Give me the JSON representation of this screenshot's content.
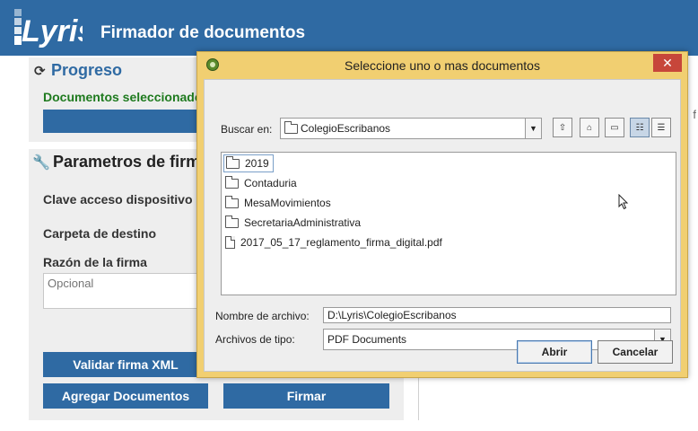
{
  "app": {
    "logo_text": "Lyris",
    "title": "Firmador de documentos"
  },
  "progress": {
    "title": "Progreso",
    "docs_label": "Documentos seleccionados"
  },
  "params": {
    "title": "Parametros de firma",
    "clave_label": "Clave acceso dispositivo",
    "carpeta_label": "Carpeta de destino",
    "razon_label": "Razón de la firma",
    "razon_placeholder": "Opcional"
  },
  "buttons": {
    "validar": "Validar firma XML",
    "agregar": "Agregar Documentos",
    "firmar": "Firmar"
  },
  "right_fragment": {
    "letter": "f"
  },
  "dialog": {
    "title": "Seleccione uno o mas documentos",
    "close_glyph": "✕",
    "look_in_label": "Buscar en:",
    "look_in_value": "ColegioEscribanos",
    "files": [
      {
        "name": "2019",
        "kind": "folder",
        "selected": true
      },
      {
        "name": "Contaduria",
        "kind": "folder"
      },
      {
        "name": "MesaMovimientos",
        "kind": "folder"
      },
      {
        "name": "SecretariaAdministrativa",
        "kind": "folder"
      },
      {
        "name": "2017_05_17_reglamento_firma_digital.pdf",
        "kind": "file"
      }
    ],
    "filename_label": "Nombre de archivo:",
    "filename_value": "D:\\Lyris\\ColegioEscribanos",
    "filetype_label": "Archivos de tipo:",
    "filetype_value": "PDF Documents",
    "open_button": "Abrir",
    "cancel_button": "Cancelar"
  },
  "colors": {
    "brand": "#2f6aa3",
    "dialog_frame": "#f1cf71",
    "close": "#c7463a",
    "docs_label": "#1e7a1e"
  }
}
